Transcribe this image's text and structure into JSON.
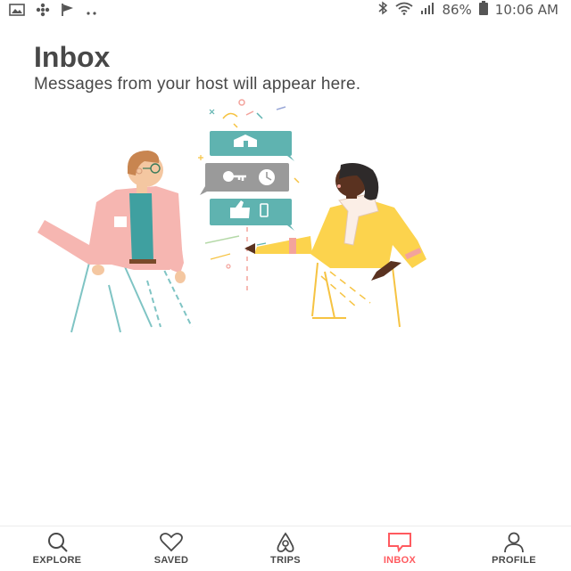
{
  "status_bar": {
    "left_icons": [
      "image-icon",
      "pinwheel-icon",
      "flag-icon",
      "more-dots-icon"
    ],
    "right_icons": [
      "bluetooth-icon",
      "wifi-icon",
      "signal-icon",
      "battery-icon"
    ],
    "battery": "86%",
    "time": "10:06 AM"
  },
  "header": {
    "title": "Inbox",
    "subtitle": "Messages from your host will appear here."
  },
  "tabs": [
    {
      "label": "EXPLORE",
      "icon": "search-icon"
    },
    {
      "label": "SAVED",
      "icon": "heart-icon"
    },
    {
      "label": "TRIPS",
      "icon": "airbnb-logo-icon"
    },
    {
      "label": "INBOX",
      "icon": "chat-bubble-icon",
      "active": true
    },
    {
      "label": "PROFILE",
      "icon": "person-icon"
    }
  ],
  "colors": {
    "accent": "#ff5a5f",
    "text": "#484848",
    "bubble_teal": "#5fb3b0",
    "bubble_gray": "#9a9a9a",
    "jacket_pink": "#f6b6b1",
    "jacket_yellow": "#fcd34d"
  }
}
